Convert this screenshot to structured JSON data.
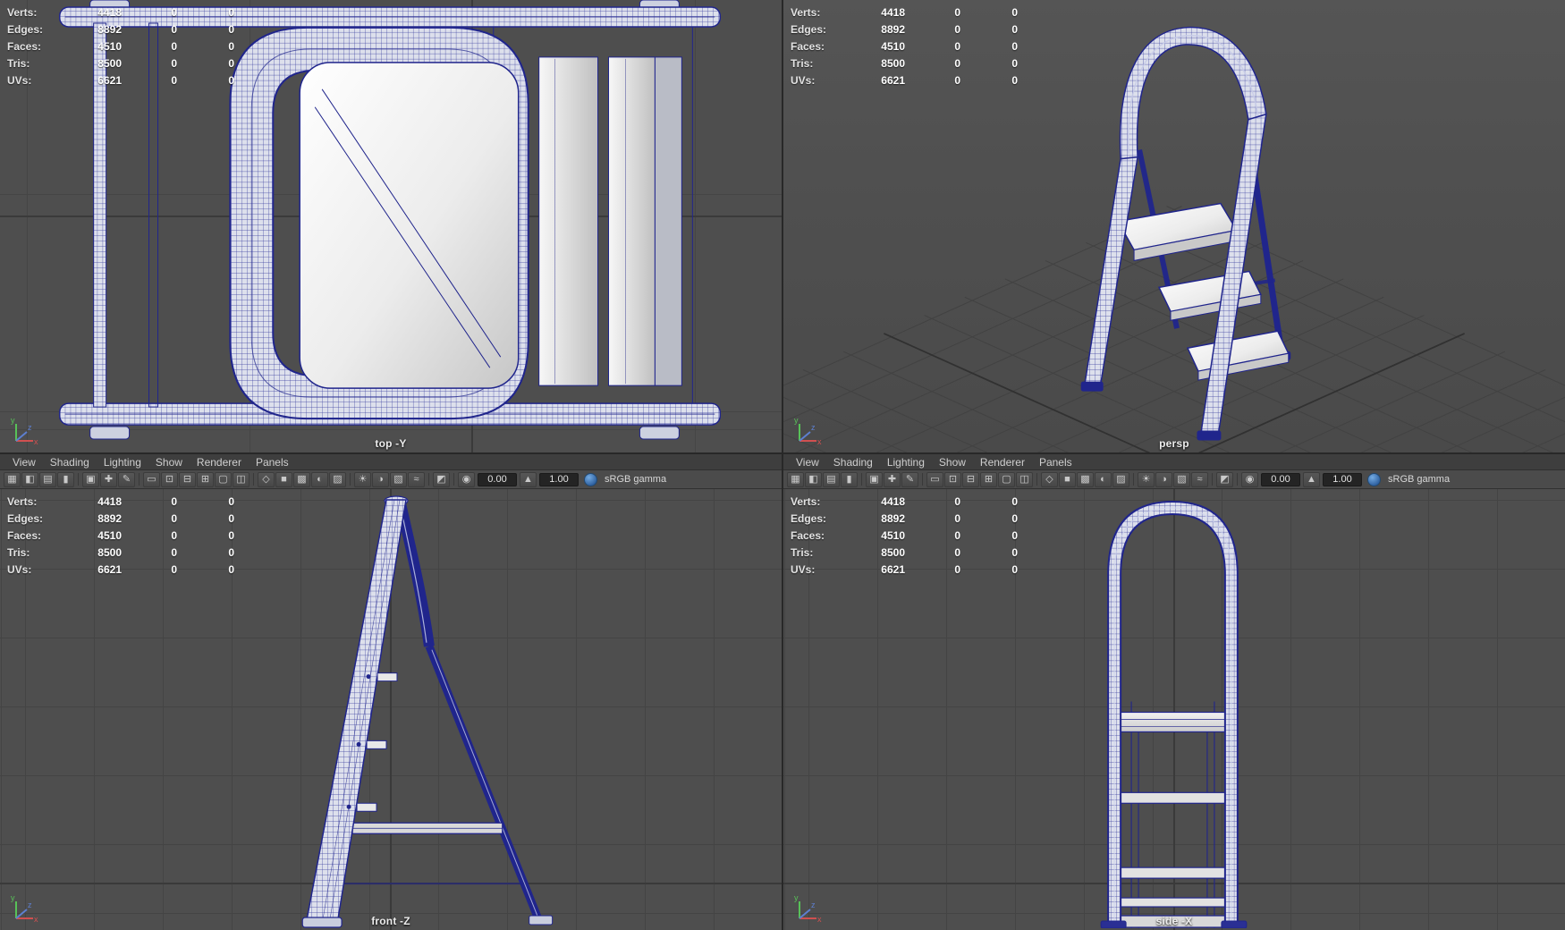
{
  "stats": {
    "rows": [
      {
        "label": "Verts:",
        "value": "4418",
        "c1": "0",
        "c2": "0"
      },
      {
        "label": "Edges:",
        "value": "8892",
        "c1": "0",
        "c2": "0"
      },
      {
        "label": "Faces:",
        "value": "4510",
        "c1": "0",
        "c2": "0"
      },
      {
        "label": "Tris:",
        "value": "8500",
        "c1": "0",
        "c2": "0"
      },
      {
        "label": "UVs:",
        "value": "6621",
        "c1": "0",
        "c2": "0"
      }
    ]
  },
  "menubar": {
    "items": [
      "View",
      "Shading",
      "Lighting",
      "Show",
      "Renderer",
      "Panels"
    ]
  },
  "toolbar": {
    "items": [
      {
        "type": "icon",
        "name": "select-camera-icon",
        "glyph": "▦"
      },
      {
        "type": "icon",
        "name": "lock-camera-icon",
        "glyph": "◧"
      },
      {
        "type": "icon",
        "name": "camera-attributes-icon",
        "glyph": "▤"
      },
      {
        "type": "icon",
        "name": "bookmark-icon",
        "glyph": "▮"
      },
      {
        "type": "sep"
      },
      {
        "type": "icon",
        "name": "image-plane-icon",
        "glyph": "▣"
      },
      {
        "type": "icon",
        "name": "2d-pan-zoom-icon",
        "glyph": "✚"
      },
      {
        "type": "icon",
        "name": "grease-pencil-icon",
        "glyph": "✎"
      },
      {
        "type": "sep"
      },
      {
        "type": "icon",
        "name": "film-gate-icon",
        "glyph": "▭"
      },
      {
        "type": "icon",
        "name": "resolution-gate-icon",
        "glyph": "⊡"
      },
      {
        "type": "icon",
        "name": "gate-mask-icon",
        "glyph": "⊟"
      },
      {
        "type": "icon",
        "name": "field-chart-icon",
        "glyph": "⊞"
      },
      {
        "type": "icon",
        "name": "safe-action-icon",
        "glyph": "▢"
      },
      {
        "type": "icon",
        "name": "safe-title-icon",
        "glyph": "◫"
      },
      {
        "type": "sep"
      },
      {
        "type": "icon",
        "name": "wireframe-display-icon",
        "glyph": "◇"
      },
      {
        "type": "icon",
        "name": "shaded-display-icon",
        "glyph": "■"
      },
      {
        "type": "icon",
        "name": "textured-display-icon",
        "glyph": "▩"
      },
      {
        "type": "icon",
        "name": "default-material-icon",
        "glyph": "◐"
      },
      {
        "type": "icon",
        "name": "xray-icon",
        "glyph": "▨"
      },
      {
        "type": "sep"
      },
      {
        "type": "icon",
        "name": "lights-icon",
        "glyph": "☀"
      },
      {
        "type": "icon",
        "name": "shadows-icon",
        "glyph": "◑"
      },
      {
        "type": "icon",
        "name": "occlusion-icon",
        "glyph": "▧"
      },
      {
        "type": "icon",
        "name": "motion-blur-icon",
        "glyph": "≈"
      },
      {
        "type": "sep"
      },
      {
        "type": "icon",
        "name": "isolate-select-icon",
        "glyph": "◩"
      },
      {
        "type": "sep"
      },
      {
        "type": "icon",
        "name": "exposure-icon",
        "glyph": "◉"
      },
      {
        "type": "field",
        "name": "exposure-field",
        "value": "0.00"
      },
      {
        "type": "icon",
        "name": "gamma-icon",
        "glyph": "▲"
      },
      {
        "type": "field",
        "name": "gamma-field",
        "value": "1.00"
      },
      {
        "type": "cm",
        "name": "color-management-icon"
      },
      {
        "type": "label",
        "name": "srgb-gamma-label",
        "text": "sRGB gamma"
      }
    ]
  },
  "viewports": {
    "top": {
      "label": "top -Y"
    },
    "persp": {
      "label": "persp"
    },
    "front": {
      "label": "front -Z"
    },
    "side": {
      "label": "side -X"
    }
  },
  "axis": {
    "x": "x",
    "y": "y",
    "z": "z"
  },
  "colors": {
    "wireframe": "#20258c",
    "viewport_bg": "#4e4e4e",
    "grid_line": "#454545",
    "menu_text": "#cfcfcf",
    "cm_blue": "#2d5f9e",
    "step_fill": "#e8e8e8"
  }
}
